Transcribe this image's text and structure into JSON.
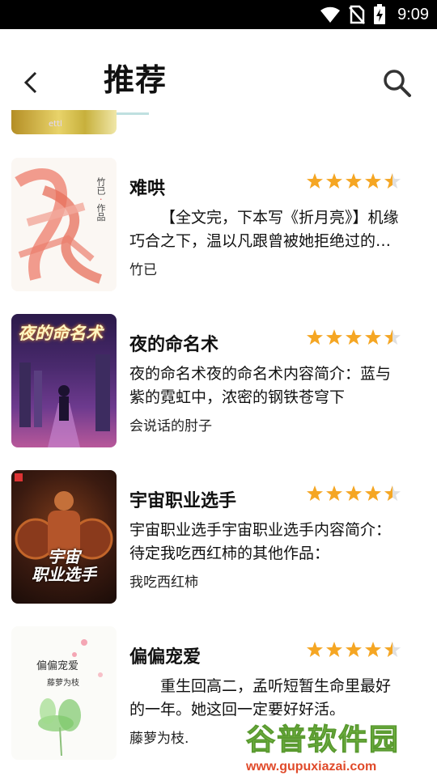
{
  "status_bar": {
    "time": "9:09"
  },
  "header": {
    "title": "推荐"
  },
  "books": [
    {
      "title": "难哄",
      "description": "【全文完，下本写《折月亮》】机缘巧合之下，温以凡跟曾被她拒绝过的桑延",
      "author": "竹已",
      "cover_text": [
        "竹已",
        "作品"
      ]
    },
    {
      "title": "夜的命名术",
      "description": "夜的命名术夜的命名术内容简介：蓝与紫的霓虹中，浓密的钢铁苍穹下",
      "author": "会说话的肘子",
      "cover_text": [
        "夜的命名术"
      ]
    },
    {
      "title": "宇宙职业选手",
      "description": "宇宙职业选手宇宙职业选手内容简介：待定我吃西红柿的其他作品：",
      "author": "我吃西红柿",
      "cover_text": [
        "宇宙",
        "职业选手"
      ]
    },
    {
      "title": "偏偏宠爱",
      "description": "重生回高二，孟听短暂生命里最好的一年。她这回一定要好好活。",
      "author": "藤萝为枝.",
      "cover_text": [
        "偏偏宠爱",
        "藤萝为枝"
      ]
    }
  ],
  "watermark": {
    "text": "谷普软件园",
    "url": "www.gupuxiazai.com"
  }
}
